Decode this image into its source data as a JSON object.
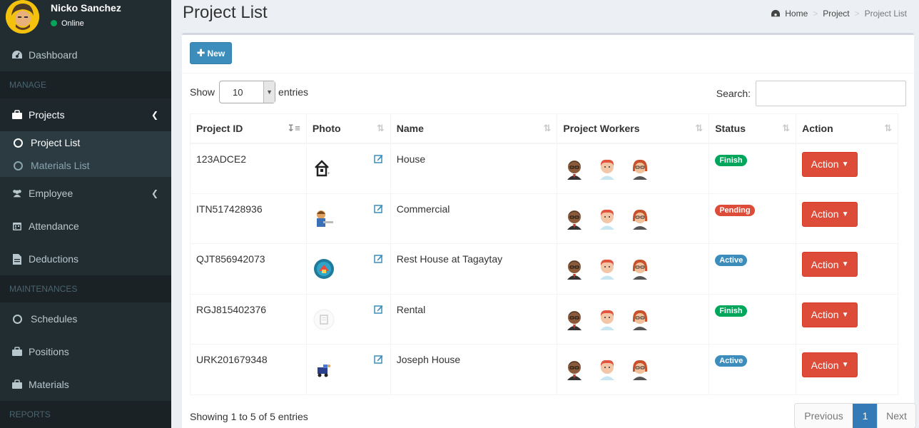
{
  "user": {
    "name": "Nicko Sanchez",
    "status": "Online"
  },
  "nav": {
    "dashboard": "Dashboard",
    "manage_header": "MANAGE",
    "projects": "Projects",
    "project_list": "Project List",
    "materials_list": "Materials List",
    "employee": "Employee",
    "attendance": "Attendance",
    "deductions": "Deductions",
    "maintenances_header": "MAINTENANCES",
    "schedules": "Schedules",
    "positions": "Positions",
    "materials": "Materials",
    "reports_header": "REPORTS"
  },
  "page": {
    "title": "Project List"
  },
  "breadcrumb": {
    "home": "Home",
    "section": "Project",
    "current": "Project List"
  },
  "toolbar": {
    "new_label": "New"
  },
  "table_controls": {
    "show_label": "Show",
    "entries_value": "10",
    "entries_label": "entries",
    "search_label": "Search:"
  },
  "columns": {
    "id": "Project ID",
    "photo": "Photo",
    "name": "Name",
    "workers": "Project Workers",
    "status": "Status",
    "action": "Action"
  },
  "rows": [
    {
      "id": "123ADCE2",
      "name": "House",
      "status": "Finish",
      "status_color": "#00a65a",
      "action": "Action"
    },
    {
      "id": "ITN517428936",
      "name": "Commercial",
      "status": "Pending",
      "status_color": "#dd4b39",
      "action": "Action"
    },
    {
      "id": "QJT856942073",
      "name": "Rest House at Tagaytay",
      "status": "Active",
      "status_color": "#3c8dbc",
      "action": "Action"
    },
    {
      "id": "RGJ815402376",
      "name": "Rental",
      "status": "Finish",
      "status_color": "#00a65a",
      "action": "Action"
    },
    {
      "id": "URK201679348",
      "name": "Joseph House",
      "status": "Active",
      "status_color": "#3c8dbc",
      "action": "Action"
    }
  ],
  "footer": {
    "info": "Showing 1 to 5 of 5 entries",
    "previous": "Previous",
    "page": "1",
    "next": "Next"
  }
}
